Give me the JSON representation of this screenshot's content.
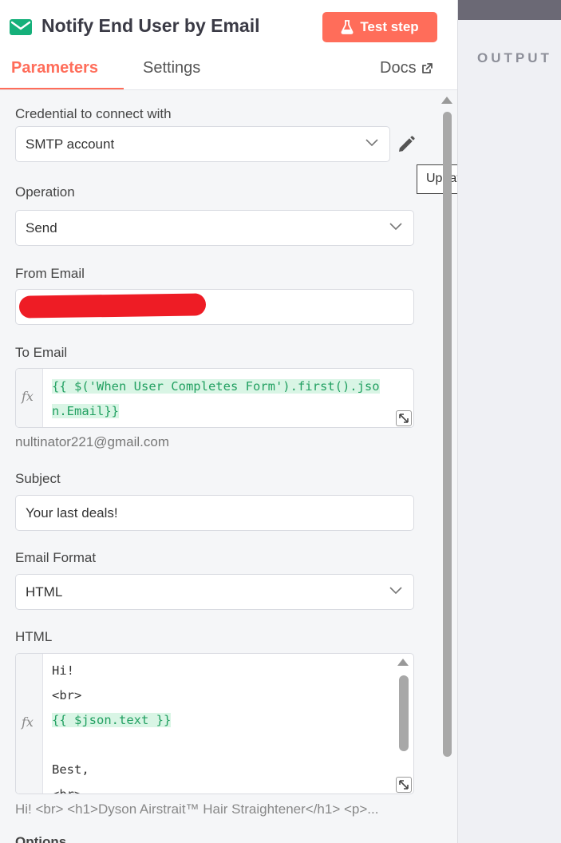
{
  "header": {
    "title": "Notify End User by Email",
    "test_button_label": "Test step",
    "tabs": [
      {
        "label": "Parameters",
        "active": true
      },
      {
        "label": "Settings",
        "active": false
      },
      {
        "label": "Docs",
        "active": false
      }
    ]
  },
  "output": {
    "label": "OUTPUT"
  },
  "credential": {
    "label": "Credential to connect with",
    "value": "SMTP account",
    "tooltip": "Update Credential"
  },
  "operation": {
    "label": "Operation",
    "value": "Send"
  },
  "from_email": {
    "label": "From Email"
  },
  "to_email": {
    "label": "To Email",
    "line1": "{{ $('When User Completes Form').first().jso",
    "line2": "n.Email}}",
    "resolved": "nultinator221@gmail.com"
  },
  "subject": {
    "label": "Subject",
    "value": "Your last deals!"
  },
  "email_format": {
    "label": "Email Format",
    "value": "HTML"
  },
  "html": {
    "label": "HTML",
    "lines": [
      "Hi!",
      "<br>",
      "{{ $json.text }}",
      "",
      "Best,",
      "<br>"
    ],
    "preview": "Hi! <br> <h1>Dyson Airstrait™ Hair Straightener</h1> <p>..."
  },
  "options": {
    "label": "Options"
  },
  "colors": {
    "accent": "#ff6d5a",
    "expression": "#22a061",
    "email_icon": "#15b07a"
  }
}
